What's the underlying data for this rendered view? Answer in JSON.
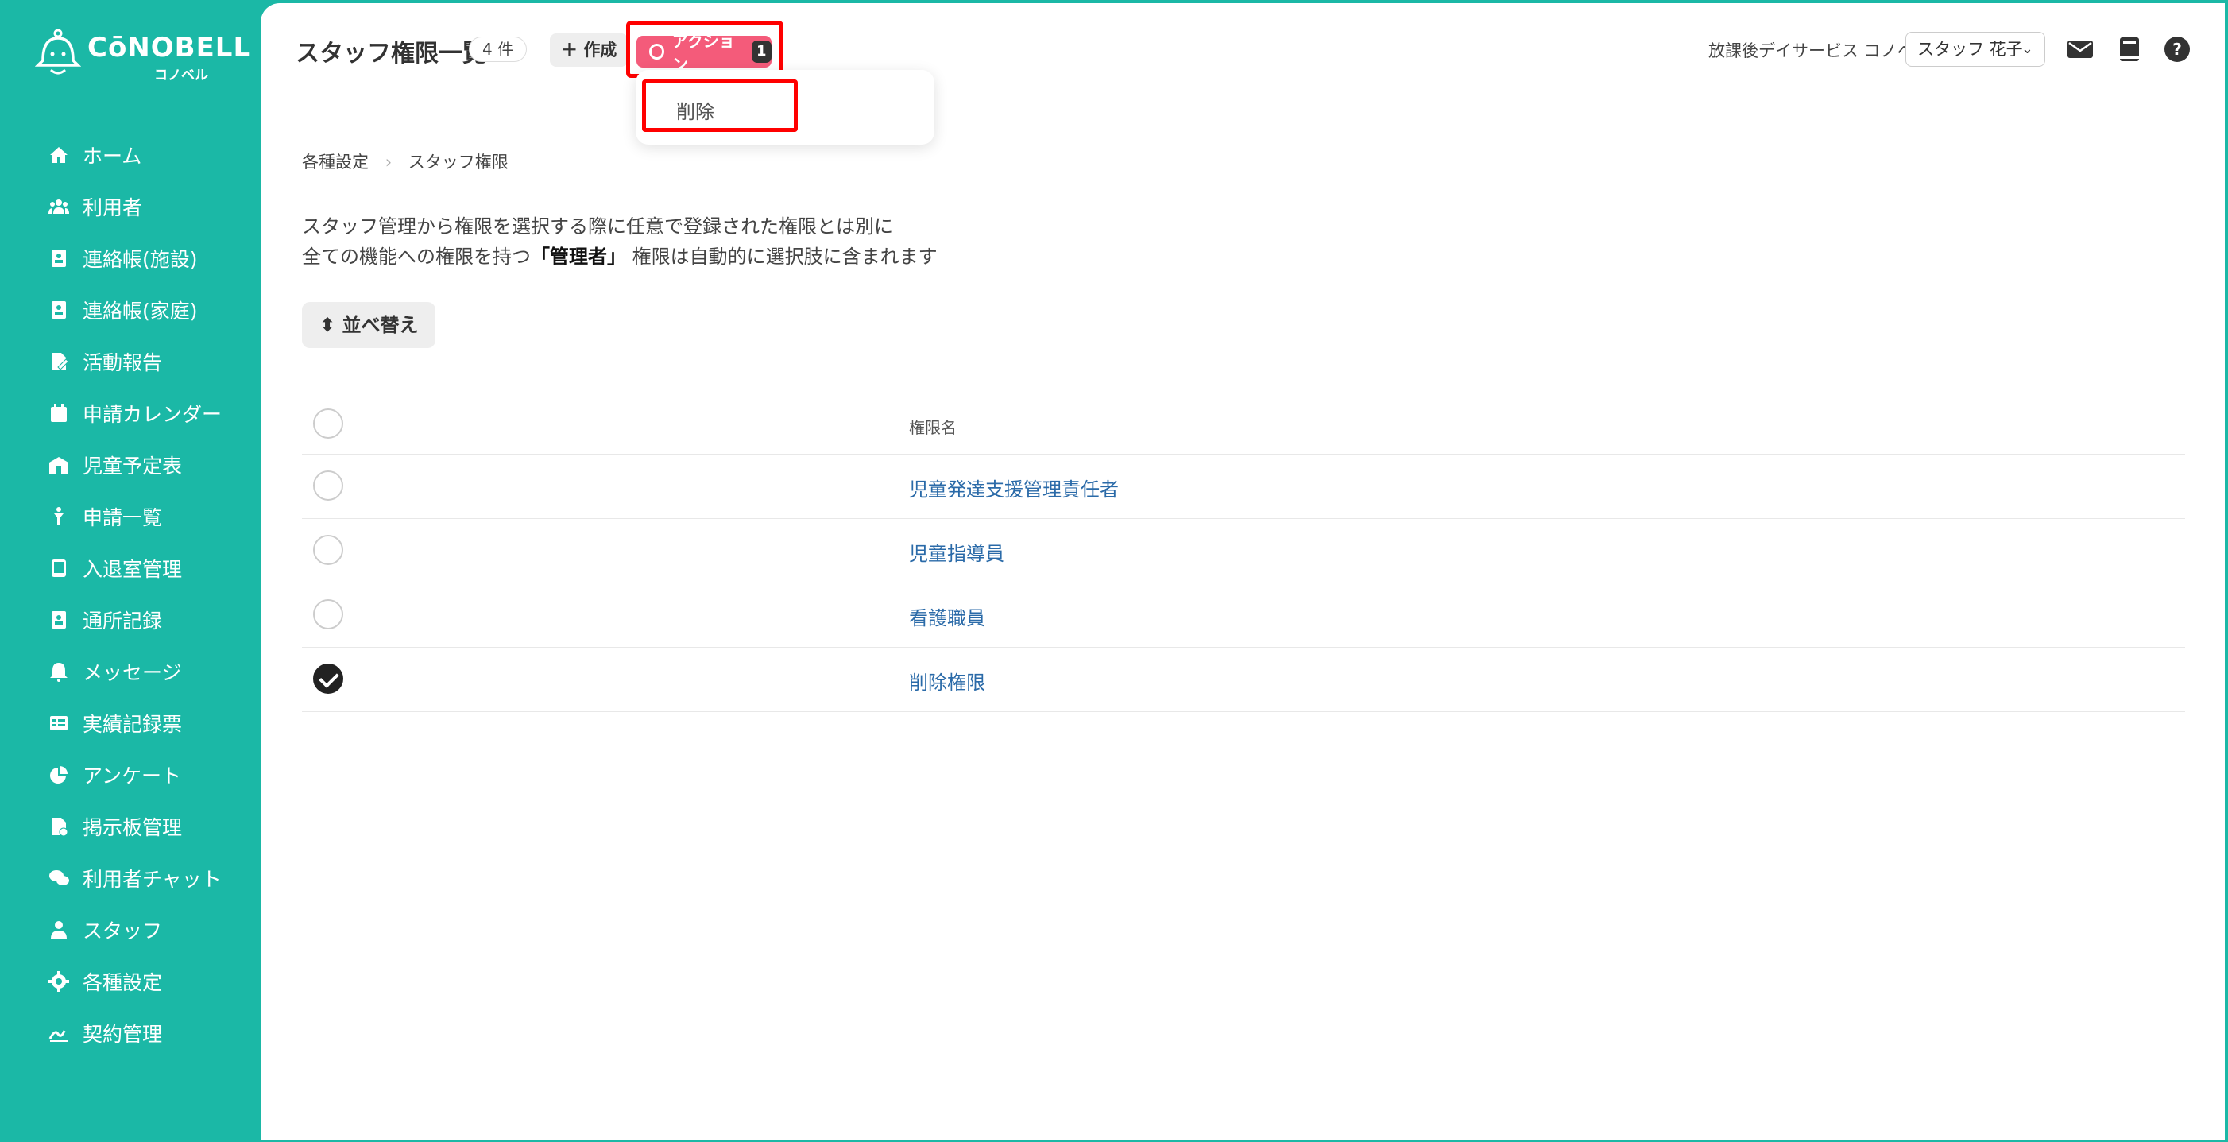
{
  "brand": {
    "name": "CōNOBELL",
    "sub": "コノベル"
  },
  "sidebar": {
    "items": [
      {
        "label": "ホーム",
        "icon": "home-icon"
      },
      {
        "label": "利用者",
        "icon": "users-icon"
      },
      {
        "label": "連絡帳(施設)",
        "icon": "contact-book-icon"
      },
      {
        "label": "連絡帳(家庭)",
        "icon": "contact-book-icon"
      },
      {
        "label": "活動報告",
        "icon": "report-icon"
      },
      {
        "label": "申請カレンダー",
        "icon": "calendar-icon"
      },
      {
        "label": "児童予定表",
        "icon": "school-icon"
      },
      {
        "label": "申請一覧",
        "icon": "child-icon"
      },
      {
        "label": "入退室管理",
        "icon": "tablet-icon"
      },
      {
        "label": "通所記録",
        "icon": "record-icon"
      },
      {
        "label": "メッセージ",
        "icon": "bell-icon"
      },
      {
        "label": "実績記録票",
        "icon": "table-icon"
      },
      {
        "label": "アンケート",
        "icon": "pie-chart-icon"
      },
      {
        "label": "掲示板管理",
        "icon": "board-icon"
      },
      {
        "label": "利用者チャット",
        "icon": "chat-icon"
      },
      {
        "label": "スタッフ",
        "icon": "staff-icon"
      },
      {
        "label": "各種設定",
        "icon": "gear-icon"
      },
      {
        "label": "契約管理",
        "icon": "contract-icon"
      }
    ]
  },
  "header": {
    "title": "スタッフ権限一覧",
    "count": "4 件",
    "create_label": "作成",
    "action_label": "アクション",
    "action_count": "1",
    "dropdown_delete": "削除",
    "facility": "放課後デイサービス コノベル",
    "staff_name": "スタッフ 花子"
  },
  "breadcrumb": {
    "parent": "各種設定",
    "current": "スタッフ権限"
  },
  "description": {
    "line1": "スタッフ管理から権限を選択する際に任意で登録された権限とは別に",
    "line2_pre": "全ての機能への権限を持つ",
    "line2_bold": "「管理者」",
    "line2_post": "権限は自動的に選択肢に含まれます"
  },
  "sort_label": "並べ替え",
  "table": {
    "column": "権限名",
    "rows": [
      {
        "name": "児童発達支援管理責任者",
        "checked": false
      },
      {
        "name": "児童指導員",
        "checked": false
      },
      {
        "name": "看護職員",
        "checked": false
      },
      {
        "name": "削除権限",
        "checked": true
      }
    ]
  },
  "colors": {
    "accent": "#1bb8a6",
    "action": "#f45b7a",
    "link": "#2a6aa8",
    "highlight": "#ff0000"
  }
}
